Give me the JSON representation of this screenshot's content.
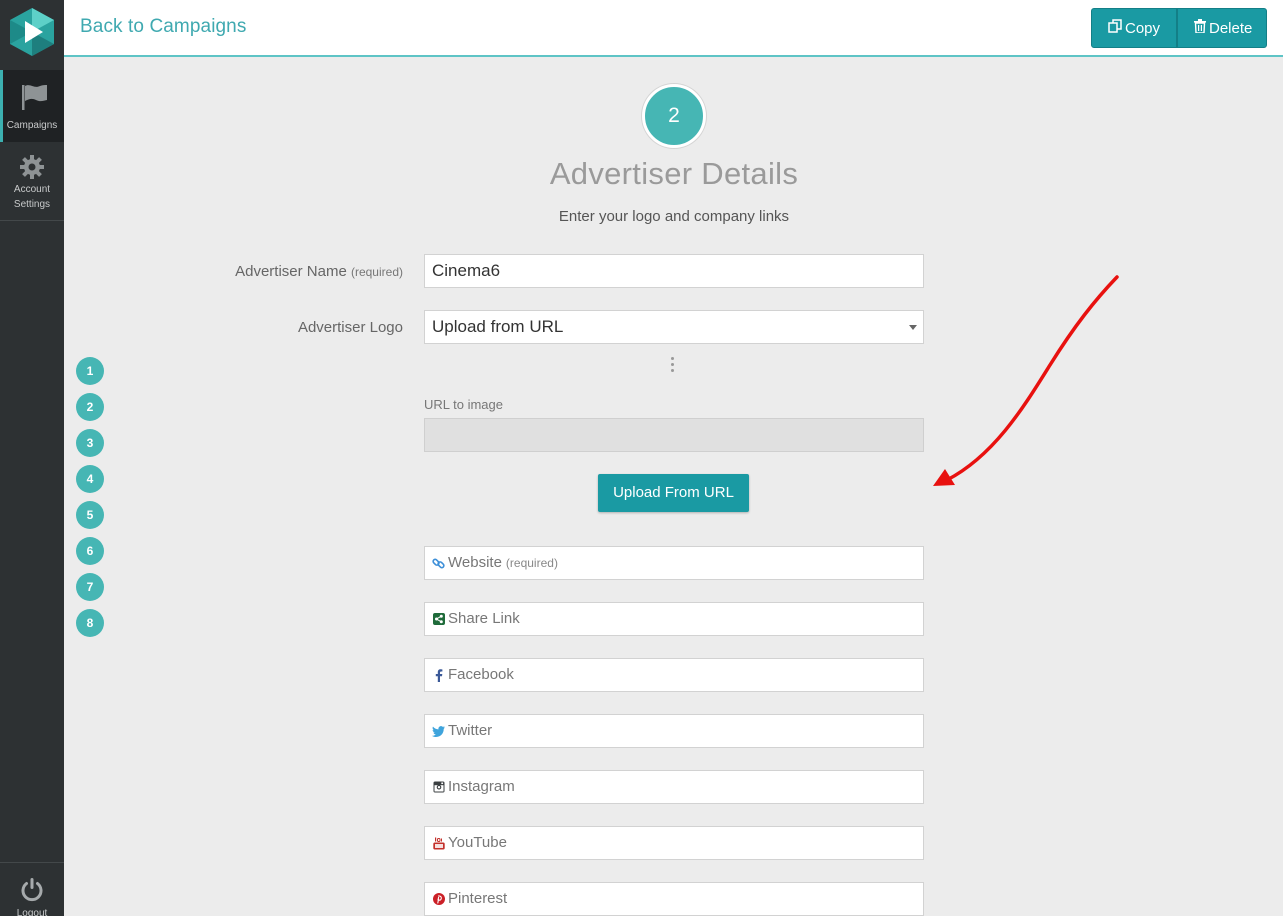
{
  "sidebar": {
    "items": [
      {
        "label": "Campaigns",
        "icon": "flag-icon"
      },
      {
        "label": "Account Settings",
        "icon": "gear-icon"
      }
    ],
    "logout_label": "Logout"
  },
  "topbar": {
    "back_label": "Back to Campaigns",
    "copy_label": "Copy",
    "delete_label": "Delete"
  },
  "step": {
    "number": "2",
    "title": "Advertiser Details",
    "subtitle": "Enter your logo and company links"
  },
  "form": {
    "advertiser_name_label": "Advertiser Name",
    "advertiser_name_required": "(required)",
    "advertiser_name_value": "Cinema6",
    "advertiser_logo_label": "Advertiser Logo",
    "advertiser_logo_selected": "Upload from URL",
    "url_label": "URL to image",
    "url_value": "",
    "upload_button": "Upload From URL",
    "links": [
      {
        "placeholder": "Website",
        "required": "(required)",
        "icon": "link-icon"
      },
      {
        "placeholder": "Share Link",
        "icon": "share-icon"
      },
      {
        "placeholder": "Facebook",
        "icon": "facebook-icon"
      },
      {
        "placeholder": "Twitter",
        "icon": "twitter-icon"
      },
      {
        "placeholder": "Instagram",
        "icon": "instagram-icon"
      },
      {
        "placeholder": "YouTube",
        "icon": "youtube-icon"
      },
      {
        "placeholder": "Pinterest",
        "icon": "pinterest-icon"
      }
    ]
  },
  "steps": [
    "1",
    "2",
    "3",
    "4",
    "5",
    "6",
    "7",
    "8"
  ],
  "colors": {
    "accent": "#1a9aa3",
    "step_teal": "#46b6b4",
    "sidebar": "#2d3133",
    "annotation_arrow": "#e8110f"
  }
}
